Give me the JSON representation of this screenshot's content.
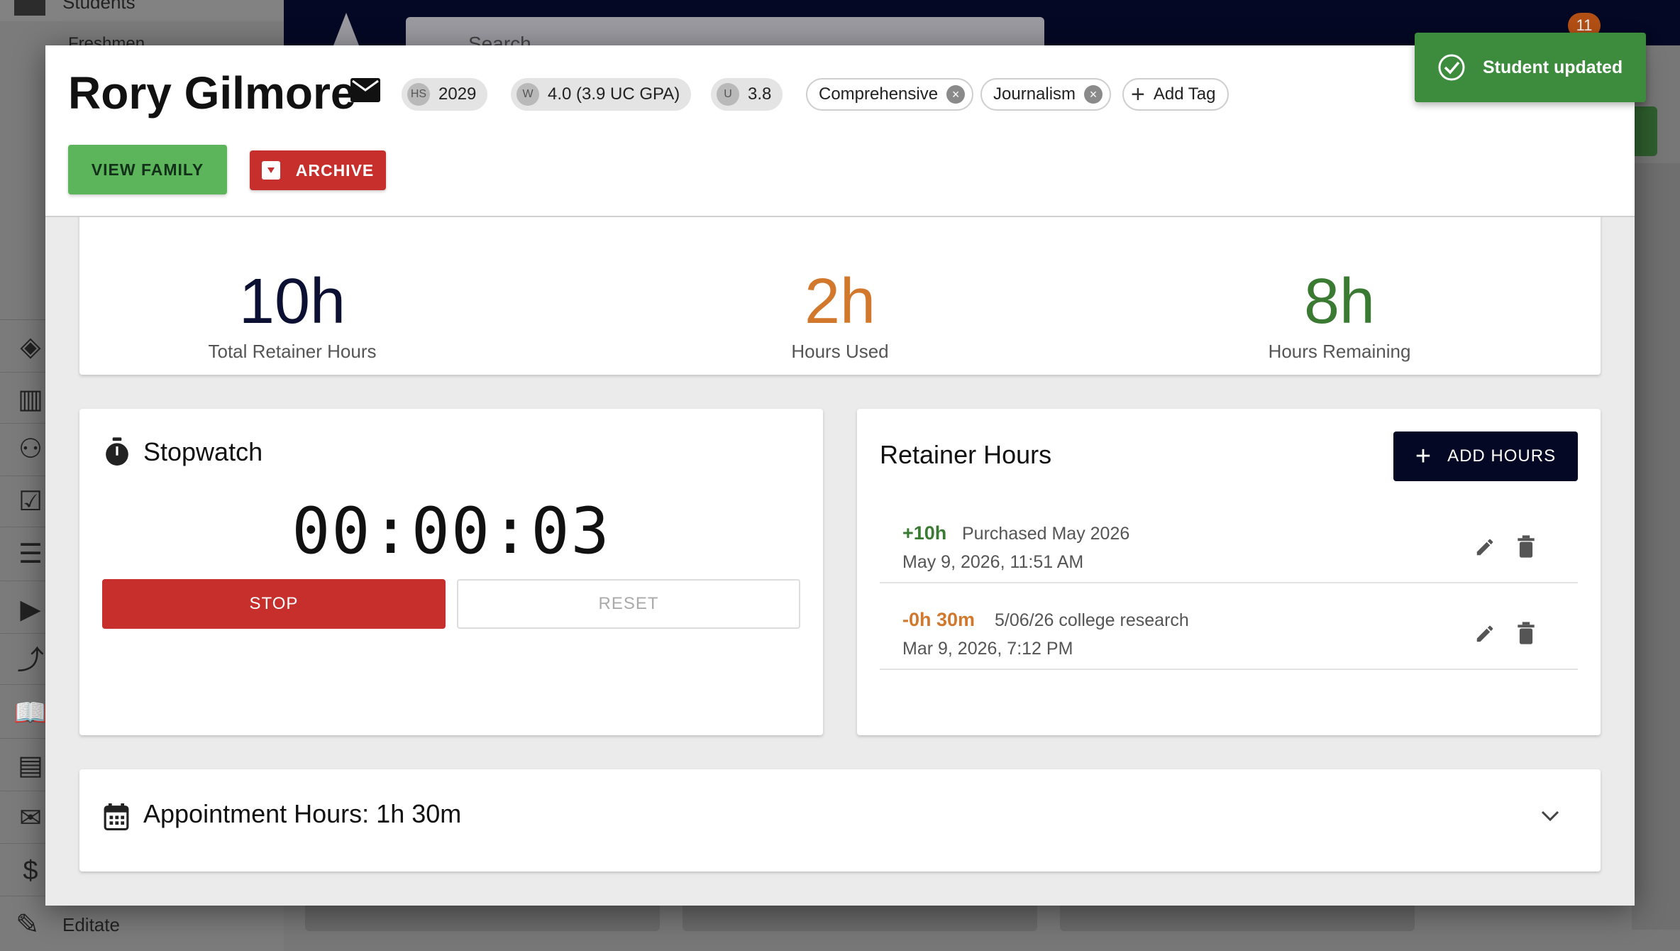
{
  "background": {
    "sidebar": {
      "top_item": "Students",
      "sub_item": "Freshmen",
      "bottom_item": "Editate"
    },
    "search": {
      "placeholder": "Search"
    },
    "notification_count": "11"
  },
  "student": {
    "name": "Rory Gilmore",
    "chips": [
      {
        "avatar": "HS",
        "value": "2029"
      },
      {
        "avatar": "W",
        "value": "4.0 (3.9 UC GPA)"
      },
      {
        "avatar": "U",
        "value": "3.8"
      }
    ],
    "tags": [
      "Comprehensive",
      "Journalism"
    ],
    "add_tag_label": "Add Tag"
  },
  "actions": {
    "view_family": "VIEW FAMILY",
    "archive": "ARCHIVE"
  },
  "stats": {
    "total": {
      "value": "10h",
      "label": "Total Retainer Hours"
    },
    "used": {
      "value": "2h",
      "label": "Hours Used"
    },
    "remaining": {
      "value": "8h",
      "label": "Hours Remaining"
    }
  },
  "stopwatch": {
    "title": "Stopwatch",
    "time": "00:00:03",
    "stop_label": "STOP",
    "reset_label": "RESET"
  },
  "retainer": {
    "title": "Retainer Hours",
    "add_label": "ADD HOURS",
    "entries": [
      {
        "amount": "+10h",
        "description": "Purchased May 2026",
        "date": "May 9, 2026, 11:51 AM"
      },
      {
        "amount": "-0h 30m",
        "description": "5/06/26 college research",
        "date": "Mar 9, 2026, 7:12 PM"
      }
    ]
  },
  "appointments": {
    "title": "Appointment Hours: 1h 30m"
  },
  "toast": {
    "message": "Student updated"
  },
  "colors": {
    "navy": "#050824",
    "green_button": "#5cb55a",
    "red_button": "#c62f2c",
    "positive": "#3b7a33",
    "negative": "#d2782c",
    "toast": "#3d8b3d"
  }
}
